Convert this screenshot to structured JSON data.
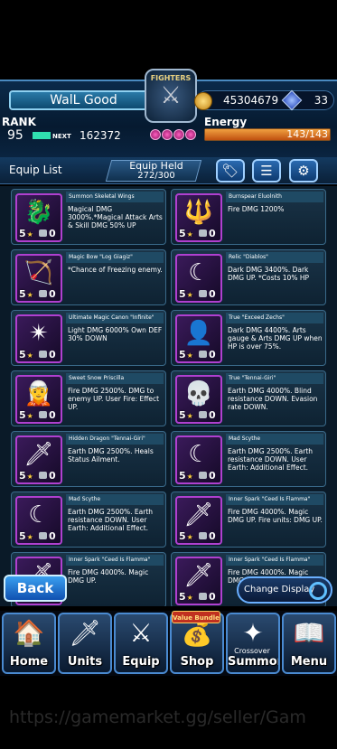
{
  "header": {
    "player_name": "WalL Good",
    "logo_text": "FIGHTERS",
    "gil": "45304679",
    "gems": "33",
    "rank_label": "RANK",
    "rank": "95",
    "next_label": "NEXT",
    "next_exp": "162372",
    "energy_label": "Energy",
    "energy": "143/143",
    "energy_fraction": 1.0
  },
  "toolbar": {
    "equip_list_label": "Equip List",
    "equip_held_label": "Equip Held",
    "equip_held_value": "272/300"
  },
  "items": [
    {
      "name": "Summon Skeletal Wings",
      "desc": "Magical DMG 3000%.*Magical Attack Arts & Skill DMG 50% UP",
      "stars": "5",
      "slots": "0",
      "icon": "wings-icon"
    },
    {
      "name": "Burnspear Eluolnith",
      "desc": "Fire DMG 1200%",
      "stars": "5",
      "slots": "0",
      "icon": "spear-icon"
    },
    {
      "name": "Magic Bow \"Log Giagiz\"",
      "desc": "*Chance of Freezing enemy.",
      "stars": "5",
      "slots": "0",
      "icon": "bow-icon"
    },
    {
      "name": "Relic \"Diablos\"",
      "desc": "Dark DMG 3400%. Dark DMG UP. *Costs 10% HP",
      "stars": "5",
      "slots": "0",
      "icon": "scythe-icon"
    },
    {
      "name": "Ultimate Magic Canon \"Infinite\"",
      "desc": "Light DMG 6000% Own DEF 30% DOWN",
      "stars": "5",
      "slots": "0",
      "icon": "cannon-icon"
    },
    {
      "name": "True \"Exceed Zechs\"",
      "desc": "Dark DMG 4400%. Arts gauge & Arts DMG UP when HP is over 75%.",
      "stars": "5",
      "slots": "0",
      "icon": "summon-icon"
    },
    {
      "name": "Sweet Snow Priscilla",
      "desc": "Fire DMG 2500%. DMG to enemy UP. User Fire: Effect UP.",
      "stars": "5",
      "slots": "0",
      "icon": "character-icon"
    },
    {
      "name": "True \"Tennai-Giri\"",
      "desc": "Earth DMG 4000%. Blind resistance DOWN. Evasion rate DOWN.",
      "stars": "5",
      "slots": "0",
      "icon": "skull-icon"
    },
    {
      "name": "Hidden Dragon \"Tennai-Giri\"",
      "desc": "Earth DMG 2500%. Heals Status Ailment.",
      "stars": "5",
      "slots": "0",
      "icon": "blade-icon"
    },
    {
      "name": "Mad Scythe",
      "desc": "Earth DMG 2500%. Earth resistance DOWN. User Earth: Additional Effect.",
      "stars": "5",
      "slots": "0",
      "icon": "scythe-icon"
    },
    {
      "name": "Mad Scythe",
      "desc": "Earth DMG 2500%. Earth resistance DOWN. User Earth: Additional Effect.",
      "stars": "5",
      "slots": "0",
      "icon": "scythe-icon"
    },
    {
      "name": "Inner Spark \"Ceed Is Flamma\"",
      "desc": "Fire DMG 4000%. Magic DMG UP. Fire units: DMG UP.",
      "stars": "5",
      "slots": "0",
      "icon": "sword-icon"
    },
    {
      "name": "Inner Spark \"Ceed Is Flamma\"",
      "desc": "Fire DMG 4000%. Magic DMG UP.",
      "stars": "5",
      "slots": "0",
      "icon": "sword-icon"
    },
    {
      "name": "Inner Spark \"Ceed Is Flamma\"",
      "desc": "Fire DMG 4000%. Magic DMG UP.",
      "stars": "5",
      "slots": "0",
      "icon": "sword-icon"
    }
  ],
  "buttons": {
    "back": "Back",
    "change_display": "Change Display"
  },
  "nav": [
    {
      "label": "Home"
    },
    {
      "label": "Units"
    },
    {
      "label": "Equip"
    },
    {
      "label": "Shop"
    },
    {
      "label": "Summon"
    },
    {
      "label": "Menu"
    }
  ],
  "nav_badges": {
    "shop": "Value Bundle",
    "summon": "Crossover"
  },
  "watermark": "https://gamemarket.gg/seller/Gam"
}
